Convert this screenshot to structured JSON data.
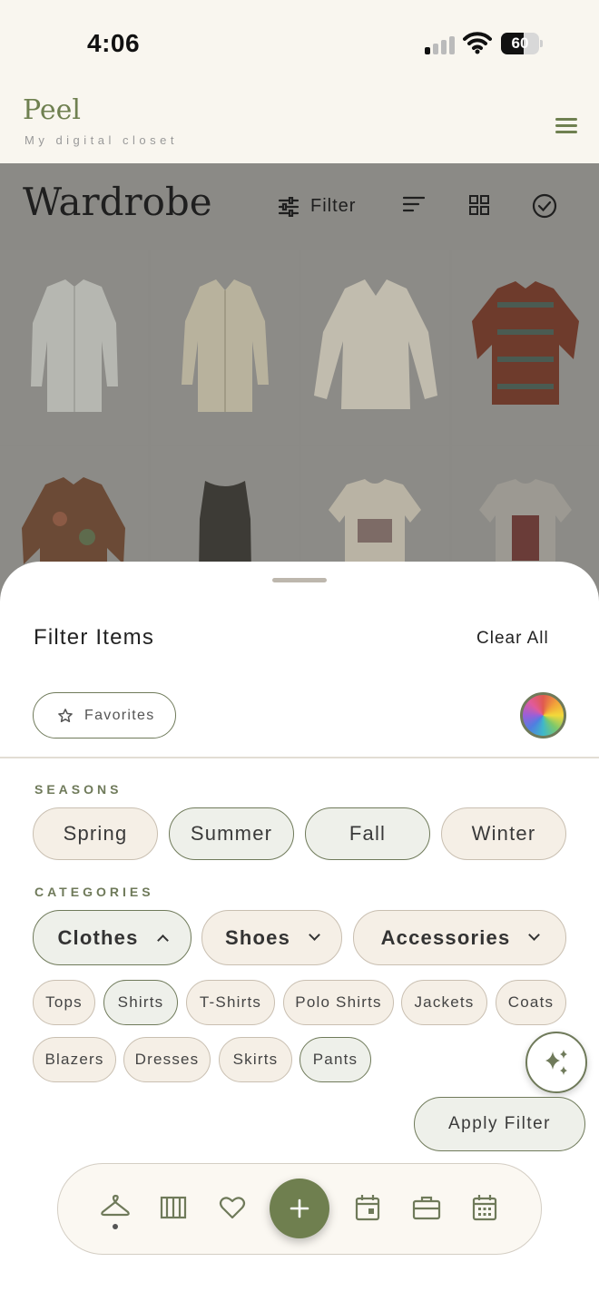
{
  "status_bar": {
    "time": "4:06",
    "battery_percent": "60",
    "battery_level": 0.6
  },
  "app": {
    "name": "Peel",
    "tagline": "My digital closet"
  },
  "wardrobe": {
    "title": "Wardrobe",
    "filter_label": "Filter",
    "items": [
      "White shirt",
      "Cream shirt",
      "White blouse",
      "Patterned shirt",
      "Floral shirt",
      "Tank top",
      "Graphic t-shirt",
      "Graphic t-shirt"
    ]
  },
  "filter_sheet": {
    "title": "Filter Items",
    "clear_all": "Clear All",
    "favorites": "Favorites",
    "seasons_label": "SEASONS",
    "seasons": [
      {
        "label": "Spring",
        "selected": false
      },
      {
        "label": "Summer",
        "selected": true
      },
      {
        "label": "Fall",
        "selected": true
      },
      {
        "label": "Winter",
        "selected": false
      }
    ],
    "categories_label": "CATEGORIES",
    "categories": [
      {
        "label": "Clothes",
        "selected": true,
        "expanded": true
      },
      {
        "label": "Shoes",
        "selected": false,
        "expanded": false
      },
      {
        "label": "Accessories",
        "selected": false,
        "expanded": false
      }
    ],
    "subcategories": [
      {
        "label": "Tops",
        "selected": false
      },
      {
        "label": "Shirts",
        "selected": true
      },
      {
        "label": "T-Shirts",
        "selected": false
      },
      {
        "label": "Polo Shirts",
        "selected": false
      },
      {
        "label": "Jackets",
        "selected": false
      },
      {
        "label": "Coats",
        "selected": false
      },
      {
        "label": "Blazers",
        "selected": false
      },
      {
        "label": "Dresses",
        "selected": false
      },
      {
        "label": "Skirts",
        "selected": false
      },
      {
        "label": "Pants",
        "selected": true
      }
    ],
    "apply": "Apply Filter"
  },
  "colors": {
    "accent": "#6f7f4f",
    "background": "#f9f6ef",
    "chip_bg": "#f5efe6",
    "chip_selected_bg": "#eef0ea"
  },
  "nav": [
    "hanger-icon",
    "wardrobe-icon",
    "heart-icon",
    "plus-icon",
    "calendar-single-icon",
    "suitcase-icon",
    "calendar-grid-icon"
  ]
}
